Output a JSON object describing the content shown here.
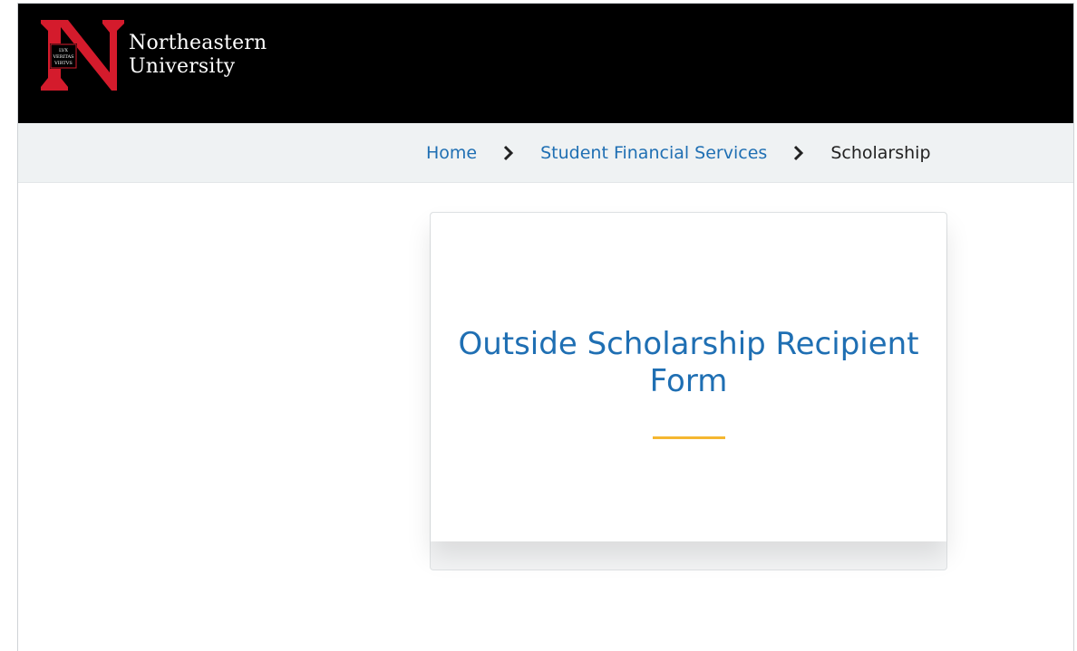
{
  "header": {
    "logo_line1": "Northeastern",
    "logo_line2": "University",
    "logo_icon": "northeastern-n-seal-icon",
    "logo_seal_text": [
      "LVX",
      "VERITAS",
      "VIRTVS"
    ]
  },
  "breadcrumb": {
    "items": [
      {
        "label": "Home",
        "link": true
      },
      {
        "label": "Student Financial Services",
        "link": true
      },
      {
        "label": "Scholarship",
        "link": false
      }
    ],
    "separator_icon": "chevron-right-icon"
  },
  "card": {
    "title": "Outside Scholarship Recipient Form"
  },
  "colors": {
    "header_bg": "#000000",
    "brand_red": "#d41b2c",
    "link_blue": "#1f6fb3",
    "accent_gold": "#f5b731",
    "breadcrumb_bg": "#eff2f3"
  }
}
